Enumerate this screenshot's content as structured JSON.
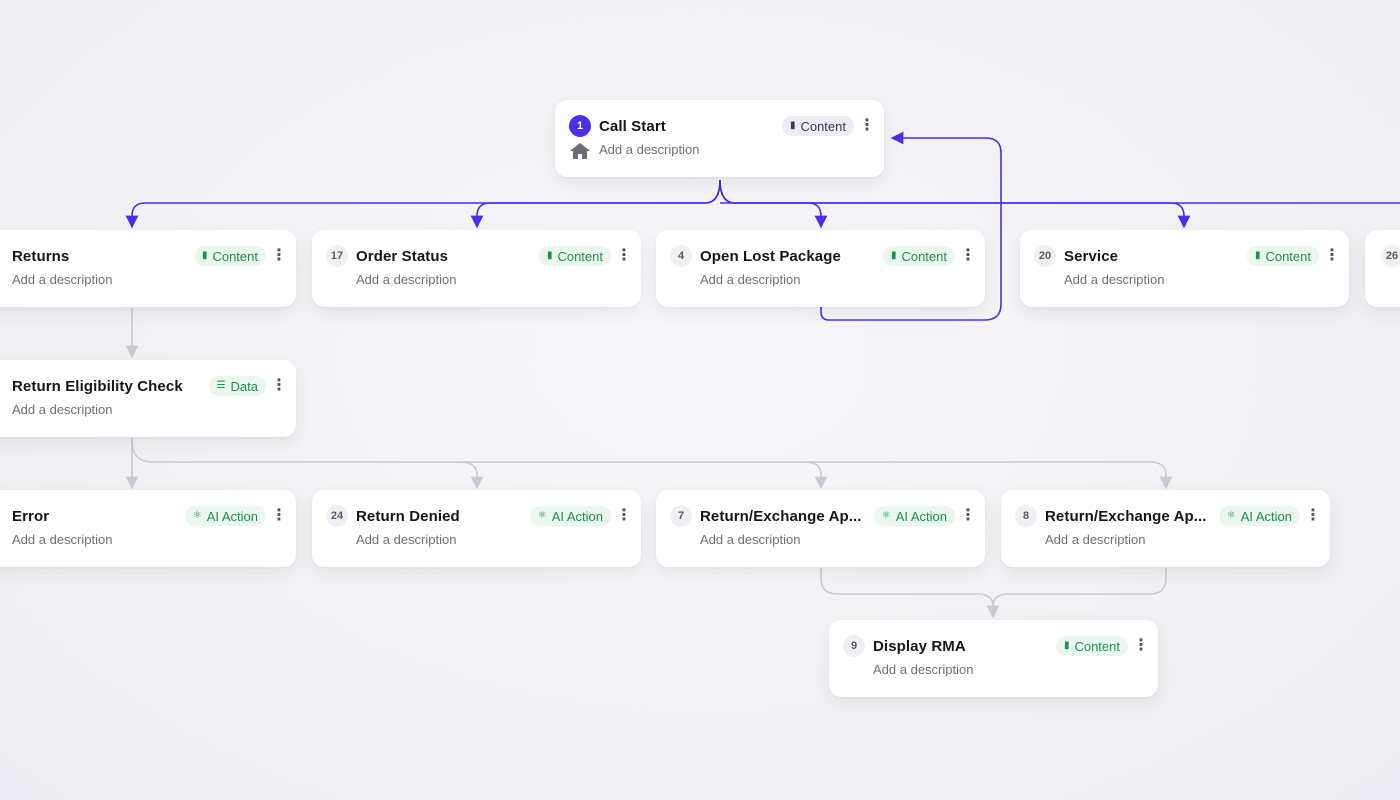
{
  "colors": {
    "accent": "#4b2ee8",
    "connector_gray": "#c9c9d3",
    "badge_green": "#1f8f4e"
  },
  "nodes": {
    "call_start": {
      "number": "1",
      "title": "Call Start",
      "badge": "Content",
      "badge_icon": "content-icon",
      "description": "Add a description",
      "icon": "home-icon"
    },
    "returns": {
      "number": "",
      "title": "Returns",
      "badge": "Content",
      "badge_icon": "content-icon",
      "description": "Add a description"
    },
    "order_status": {
      "number": "17",
      "title": "Order Status",
      "badge": "Content",
      "badge_icon": "content-icon",
      "description": "Add a description"
    },
    "open_lost_package": {
      "number": "4",
      "title": "Open Lost Package",
      "badge": "Content",
      "badge_icon": "content-icon",
      "description": "Add a description"
    },
    "service": {
      "number": "20",
      "title": "Service",
      "badge": "Content",
      "badge_icon": "content-icon",
      "description": "Add a description"
    },
    "node_26": {
      "number": "26"
    },
    "return_eligibility": {
      "number": "",
      "title": "Return Eligibility Check",
      "badge": "Data",
      "badge_icon": "data-icon",
      "description": "Add a description"
    },
    "error": {
      "number": "",
      "title": "Error",
      "badge": "AI Action",
      "badge_icon": "ai-action-icon",
      "description": "Add a description"
    },
    "return_denied": {
      "number": "24",
      "title": "Return Denied",
      "badge": "AI Action",
      "badge_icon": "ai-action-icon",
      "description": "Add a description"
    },
    "return_exchange_7": {
      "number": "7",
      "title": "Return/Exchange Ap...",
      "badge": "AI Action",
      "badge_icon": "ai-action-icon",
      "description": "Add a description"
    },
    "return_exchange_8": {
      "number": "8",
      "title": "Return/Exchange Ap...",
      "badge": "AI Action",
      "badge_icon": "ai-action-icon",
      "description": "Add a description"
    },
    "display_rma": {
      "number": "9",
      "title": "Display RMA",
      "badge": "Content",
      "badge_icon": "content-icon",
      "description": "Add a description"
    }
  }
}
